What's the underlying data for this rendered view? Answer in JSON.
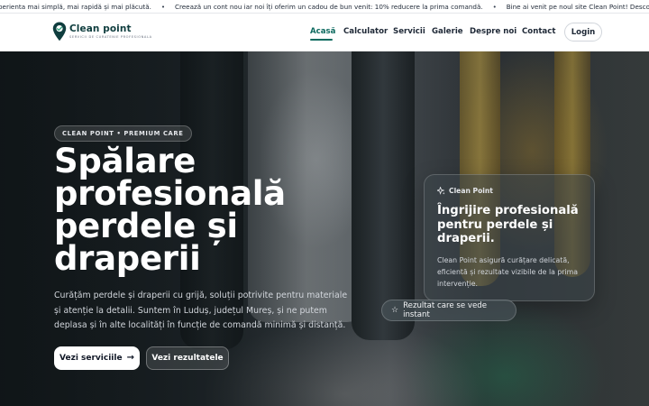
{
  "ticker": {
    "items": [
      "perienta mai simplă, mai rapidă și mai plăcută.",
      "Creează un cont nou iar noi îți oferim un cadou de bun venit: 10% reducere la prima comandă.",
      "Bine ai venit pe noul site Clean Point! Descoperă"
    ],
    "separator": "•"
  },
  "header": {
    "logo": {
      "name": "Clean point",
      "tagline": "servicii de curatenie profesionala"
    },
    "nav": [
      {
        "label": "Acasă",
        "active": true
      },
      {
        "label": "Calculator"
      },
      {
        "label": "Servicii"
      },
      {
        "label": "Galerie"
      },
      {
        "label": "Despre noi"
      },
      {
        "label": "Contact"
      }
    ],
    "login_label": "Login"
  },
  "hero": {
    "pill": "CLEAN POINT • PREMIUM CARE",
    "title": "Spălare profesională perdele și draperii",
    "description": "Curățăm perdele și draperii cu grijă, soluții potrivite pentru materiale și atenție la detalii. Suntem în Luduș, județul Mureș, și ne putem deplasa și în alte localități în funcție de comandă minimă și distanță.",
    "primary_button": "Vezi serviciile",
    "secondary_button": "Vezi rezultatele",
    "card": {
      "badge": "Clean Point",
      "title": "Îngrijire profesională pentru perdele și draperii.",
      "text": "Clean Point asigură curățare delicată, eficientă și rezultate vizibile de la prima intervenție."
    },
    "result_pill": "Rezultat care se vede instant"
  },
  "colors": {
    "brand": "#0e6b60",
    "brand_dark": "#0f3d3e",
    "text": "#1f2937"
  },
  "icons": [
    "location-pin-icon",
    "arrow-right-icon",
    "sparkle-icon",
    "star-icon"
  ]
}
